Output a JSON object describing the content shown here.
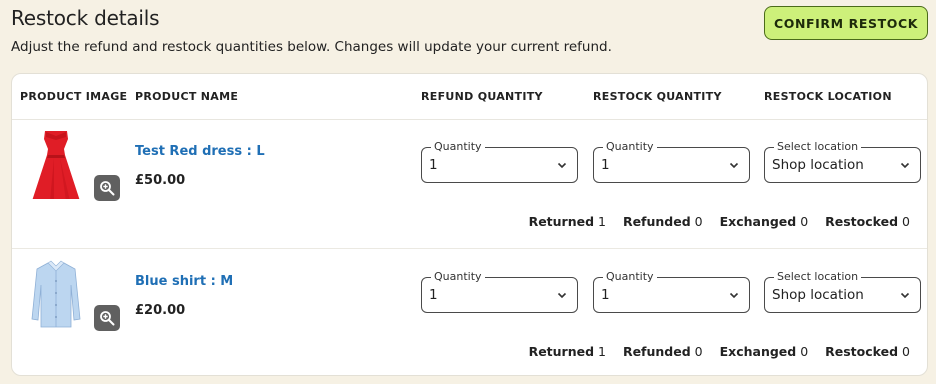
{
  "page": {
    "title": "Restock details",
    "subtitle": "Adjust the refund and restock quantities below. Changes will update your current refund.",
    "confirm_label": "CONFIRM RESTOCK"
  },
  "table": {
    "headers": {
      "image": "PRODUCT IMAGE",
      "name": "PRODUCT NAME",
      "refund_qty": "REFUND QUANTITY",
      "restock_qty": "RESTOCK QUANTITY",
      "restock_loc": "RESTOCK LOCATION"
    },
    "rows": [
      {
        "name": "Test Red dress : L",
        "price": "£50.00",
        "image": "red-dress",
        "refund": {
          "legend": "Quantity",
          "value": "1"
        },
        "restock": {
          "legend": "Quantity",
          "value": "1"
        },
        "location": {
          "legend": "Select location",
          "value": "Shop location"
        },
        "stats": {
          "returned_label": "Returned",
          "returned": "1",
          "refunded_label": "Refunded",
          "refunded": "0",
          "exchanged_label": "Exchanged",
          "exchanged": "0",
          "restocked_label": "Restocked",
          "restocked": "0"
        }
      },
      {
        "name": "Blue shirt : M",
        "price": "£20.00",
        "image": "blue-shirt",
        "refund": {
          "legend": "Quantity",
          "value": "1"
        },
        "restock": {
          "legend": "Quantity",
          "value": "1"
        },
        "location": {
          "legend": "Select location",
          "value": "Shop location"
        },
        "stats": {
          "returned_label": "Returned",
          "returned": "1",
          "refunded_label": "Refunded",
          "refunded": "0",
          "exchanged_label": "Exchanged",
          "exchanged": "0",
          "restocked_label": "Restocked",
          "restocked": "0"
        }
      }
    ]
  },
  "icons": {
    "zoom": "magnifier-plus-icon",
    "dropdown": "chevron-down-icon"
  },
  "colors": {
    "background": "#f6f1e4",
    "confirm_button": "#cdf07a",
    "link": "#1f6fb5",
    "zoom_button": "#606060"
  }
}
